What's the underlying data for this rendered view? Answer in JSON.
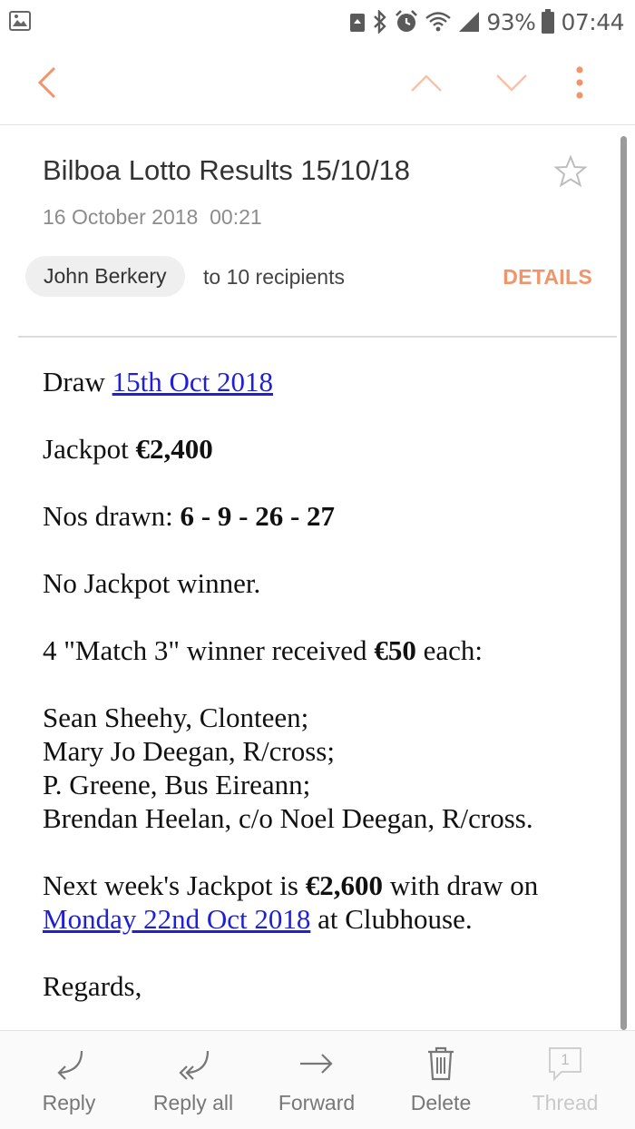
{
  "status_bar": {
    "battery": "93%",
    "time": "07:44",
    "icons": [
      "image-icon",
      "recycle-icon",
      "bluetooth-icon",
      "alarm-icon",
      "wifi-icon",
      "signal-icon",
      "battery-icon"
    ]
  },
  "toolbar": {
    "back": "back-icon",
    "prev": "chevron-up-icon",
    "next": "chevron-down-icon",
    "more": "more-vert-icon"
  },
  "email": {
    "subject": "Bilboa Lotto Results 15/10/18",
    "date": "16 October 2018  00:21",
    "sender": "John Berkery",
    "recipients": "to 10 recipients",
    "details_label": "DETAILS"
  },
  "body": {
    "draw_label": "Draw ",
    "draw_date": "15th Oct 2018",
    "jackpot_label": "Jackpot ",
    "jackpot_value": "€2,400",
    "nos_label": "Nos drawn: ",
    "nos_value": "6 - 9 - 26 - 27",
    "no_winner": "No Jackpot winner.",
    "match_prefix": "4 \"Match 3\" winner received ",
    "match_amount": "€50",
    "match_suffix": " each:",
    "winners": [
      "Sean Sheehy, Clonteen;",
      "Mary Jo Deegan, R/cross;",
      "P. Greene, Bus Eireann;",
      "Brendan Heelan, c/o Noel Deegan, R/cross."
    ],
    "next_prefix": "Next week's Jackpot is ",
    "next_amount": "€2,600",
    "next_mid": " with draw on ",
    "next_date": "Monday 22nd Oct 2018",
    "next_suffix": " at Clubhouse.",
    "regards": "Regards,"
  },
  "bottom_bar": {
    "reply": "Reply",
    "reply_all": "Reply all",
    "forward": "Forward",
    "delete": "Delete",
    "thread": "Thread",
    "thread_count": "1"
  },
  "colors": {
    "accent": "#f0956b",
    "link": "#1f1fd6",
    "muted": "#8c8c8c"
  }
}
